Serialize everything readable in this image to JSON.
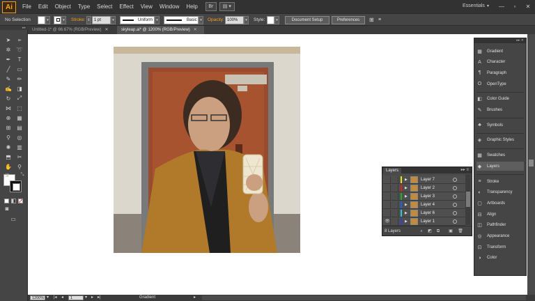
{
  "app": {
    "logo_text": "Ai"
  },
  "menu": [
    "File",
    "Edit",
    "Object",
    "Type",
    "Select",
    "Effect",
    "View",
    "Window",
    "Help"
  ],
  "menubar": {
    "bridge_label": "Br",
    "arrange_label": "▤ ▾"
  },
  "workspace": {
    "label": "Essentials",
    "arrow": "▾"
  },
  "window_controls": {
    "minimize": "—",
    "restore": "▫",
    "close": "✕"
  },
  "control_bar": {
    "selection_status": "No Selection",
    "stroke_label": "Stroke:",
    "stroke_weight": "1 pt",
    "uniform_label": "Uniform",
    "basic_label": "Basic",
    "opacity_label": "Opacity:",
    "opacity_value": "100%",
    "style_label": "Style:",
    "document_setup": "Document Setup",
    "preferences": "Preferences",
    "arrow": "▾"
  },
  "tabs": [
    {
      "label": "Untitled-1* @ 66.67% (RGB/Preview)",
      "close": "✕"
    },
    {
      "label": "skyleap.ai* @ 1200% (RGB/Preview)",
      "close": "✕"
    }
  ],
  "toolbox": {
    "grip": "▸▸"
  },
  "status_bar": {
    "zoom": "1200%",
    "artboard": "1",
    "tool_name": "Gradient",
    "arrow": "▾",
    "nav_first": "|◂",
    "nav_prev": "◂",
    "nav_next": "▸",
    "nav_last": "▸|",
    "play": "▸"
  },
  "dock": {
    "header": "▸▸ ✕",
    "items": [
      {
        "label": "Gradient",
        "icon": "gradient-icon",
        "glyph": "▦"
      },
      {
        "label": "Character",
        "icon": "character-icon",
        "glyph": "A"
      },
      {
        "label": "Paragraph",
        "icon": "paragraph-icon",
        "glyph": "¶"
      },
      {
        "label": "OpenType",
        "icon": "opentype-icon",
        "glyph": "O"
      },
      {
        "label": "Color Guide",
        "icon": "color-guide-icon",
        "glyph": "◧"
      },
      {
        "label": "Brushes",
        "icon": "brushes-icon",
        "glyph": "✎"
      },
      {
        "label": "Symbols",
        "icon": "symbols-icon",
        "glyph": "♣"
      },
      {
        "label": "Graphic Styles",
        "icon": "graphic-styles-icon",
        "glyph": "◈"
      },
      {
        "label": "Swatches",
        "icon": "swatches-icon",
        "glyph": "▩"
      },
      {
        "label": "Layers",
        "icon": "layers-icon",
        "glyph": "◆"
      },
      {
        "label": "Stroke",
        "icon": "stroke-icon",
        "glyph": "≡"
      },
      {
        "label": "Transparency",
        "icon": "transparency-icon",
        "glyph": "◐"
      },
      {
        "label": "Artboards",
        "icon": "artboards-icon",
        "glyph": "▢"
      },
      {
        "label": "Align",
        "icon": "align-icon",
        "glyph": "⊟"
      },
      {
        "label": "Pathfinder",
        "icon": "pathfinder-icon",
        "glyph": "◫"
      },
      {
        "label": "Appearance",
        "icon": "appearance-icon",
        "glyph": "◎"
      },
      {
        "label": "Transform",
        "icon": "transform-icon",
        "glyph": "⊡"
      },
      {
        "label": "Color",
        "icon": "color-icon",
        "glyph": "◑"
      }
    ]
  },
  "layers_panel": {
    "title": "Layers",
    "menu_glyph": "▸▸ ≡",
    "count_label": "8 Layers",
    "layers": [
      {
        "name": "Layer 7",
        "color": "#e8e020",
        "visible": false
      },
      {
        "name": "Layer 2",
        "color": "#e02020",
        "visible": false
      },
      {
        "name": "Layer 3",
        "color": "#20b020",
        "visible": false
      },
      {
        "name": "Layer 4",
        "color": "#2060e0",
        "visible": false
      },
      {
        "name": "Layer 6",
        "color": "#30c8c8",
        "visible": false
      },
      {
        "name": "Layer 1",
        "color": "#3040d0",
        "visible": true
      }
    ],
    "eye_glyph": "👁",
    "arrow_glyph": "▶"
  },
  "colors": {
    "accent_orange": "#f59a23",
    "selected_dock": "#5e5e5e"
  }
}
